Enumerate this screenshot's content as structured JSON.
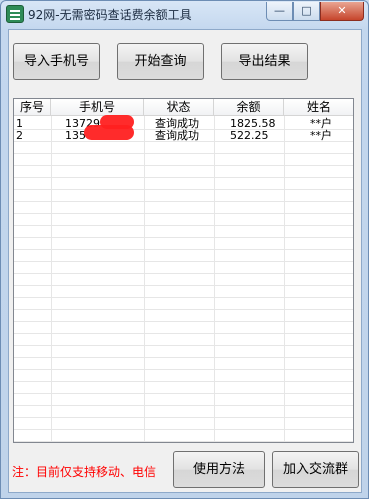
{
  "window": {
    "title": "92网-无需密码查话费余额工具",
    "controls": {
      "minimize": "—",
      "maximize": "□",
      "close": "✕"
    }
  },
  "toolbar": {
    "import_label": "导入手机号",
    "start_label": "开始查询",
    "export_label": "导出结果"
  },
  "table": {
    "columns": [
      "序号",
      "手机号",
      "状态",
      "余额",
      "姓名"
    ],
    "rows": [
      {
        "index": "1",
        "phone": "13729",
        "status": "查询成功",
        "balance": "1825.58",
        "name": "**户"
      },
      {
        "index": "2",
        "phone": "135",
        "status": "查询成功",
        "balance": "522.25",
        "name": "**户"
      }
    ]
  },
  "footer": {
    "note": "注：目前仅支持移动、电信",
    "usage_label": "使用方法",
    "join_group_label": "加入交流群"
  },
  "colors": {
    "note_text": "#ff0000",
    "redaction": "#ff2020",
    "titlebar": "#c3d7ee"
  },
  "icons": {
    "app": "app-logo-icon"
  }
}
